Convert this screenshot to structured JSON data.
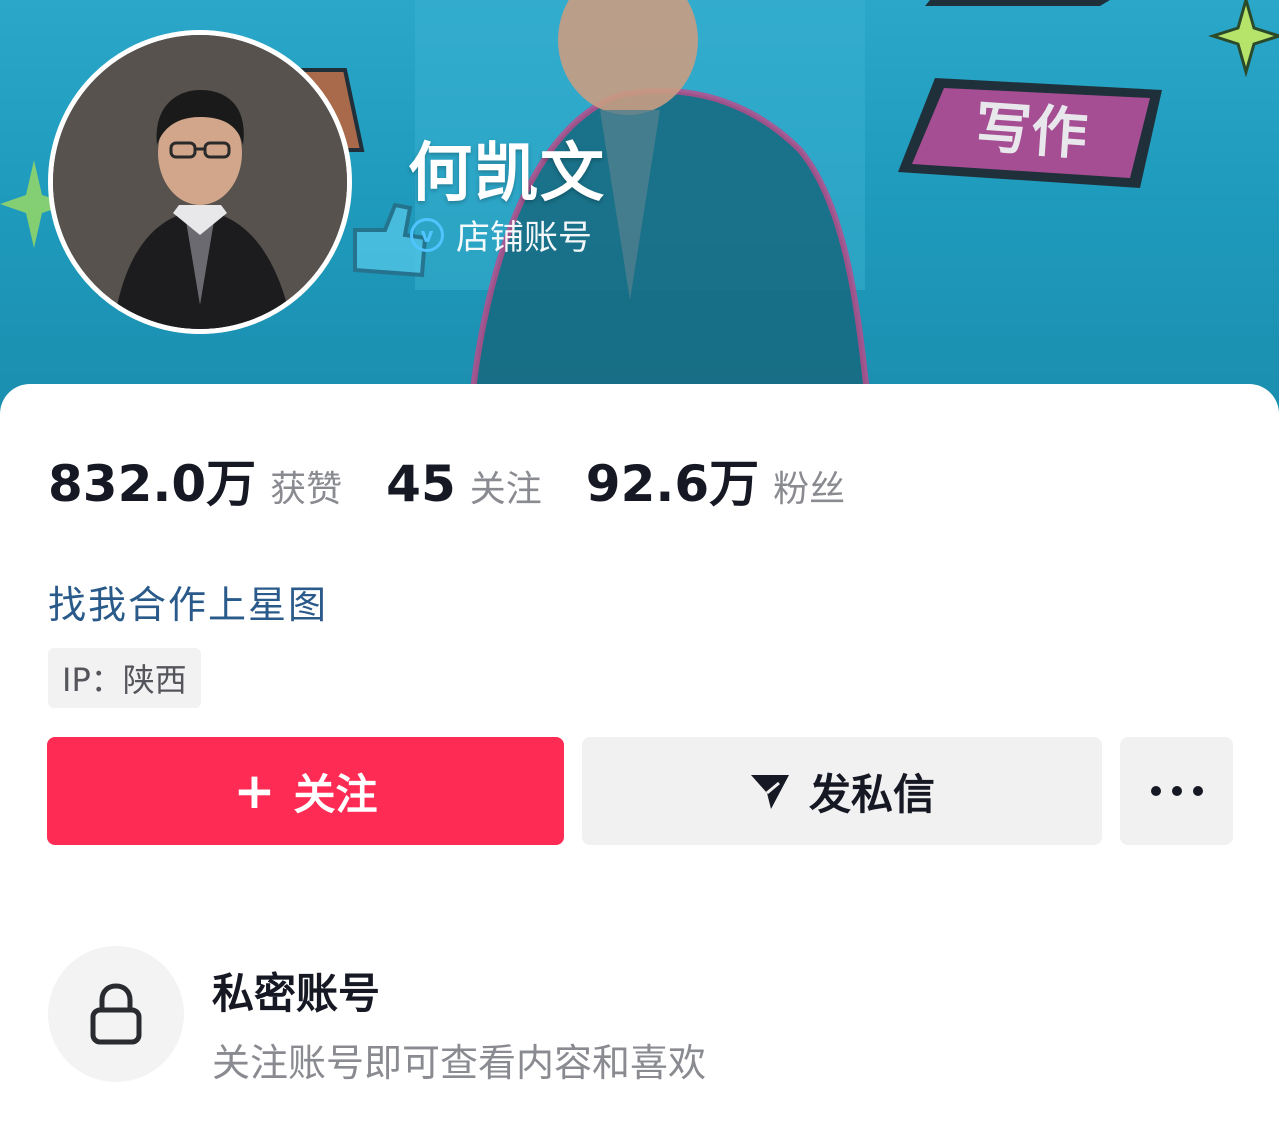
{
  "profile": {
    "name": "何凯文",
    "verify_label": "店铺账号",
    "banner_tag": "写作"
  },
  "stats": [
    {
      "value": "832.0万",
      "label": "获赞"
    },
    {
      "value": "45",
      "label": "关注"
    },
    {
      "value": "92.6万",
      "label": "粉丝"
    }
  ],
  "cooperation_link": "找我合作上星图",
  "ip_tag": "IP：陕西",
  "actions": {
    "follow_label": "关注",
    "follow_icon": "plus-icon",
    "message_label": "发私信",
    "message_icon": "send-icon",
    "more_icon": "more-dots-icon"
  },
  "private_account": {
    "title": "私密账号",
    "description": "关注账号即可查看内容和喜欢",
    "icon": "lock-icon"
  },
  "colors": {
    "banner": "#1f9bbd",
    "follow_button": "#fe2c55",
    "link": "#2a5a8a",
    "secondary_button": "#f1f1f2"
  }
}
